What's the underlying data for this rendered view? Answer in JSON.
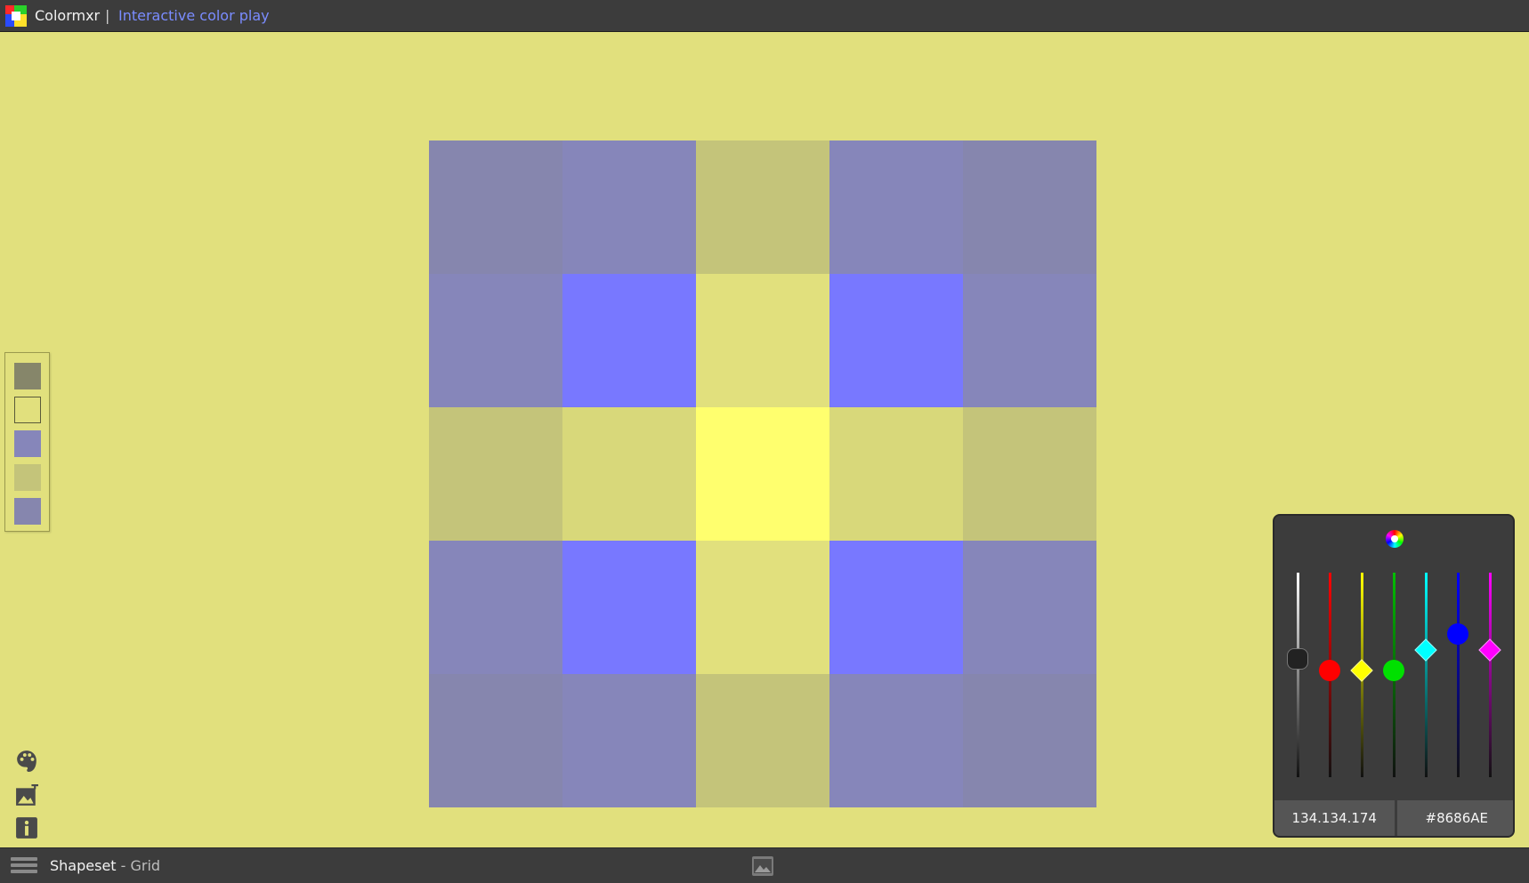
{
  "header": {
    "app_name": "Colormxr",
    "separator": "|",
    "subtitle": "Interactive color play"
  },
  "colors": {
    "background": "#e1e07d",
    "chrome": "#3c3c3c",
    "accent_link": "#7a8cff"
  },
  "grid": {
    "rows": [
      [
        "#8686AE",
        "#8686BA",
        "#C4C47A",
        "#8686BA",
        "#8686AE"
      ],
      [
        "#8686BA",
        "#7878FF",
        "#E1E07D",
        "#7878FF",
        "#8686BA"
      ],
      [
        "#C4C47A",
        "#D8D87A",
        "#FFFF6E",
        "#D8D87A",
        "#C4C47A"
      ],
      [
        "#8686BA",
        "#7878FF",
        "#E1E07D",
        "#7878FF",
        "#8686BA"
      ],
      [
        "#8686AE",
        "#8686BA",
        "#C4C47A",
        "#8686BA",
        "#8686AE"
      ]
    ]
  },
  "swatches": [
    {
      "color": "#86866A",
      "selected": false
    },
    {
      "color": "#E1E07D",
      "selected": true
    },
    {
      "color": "#8686BA",
      "selected": false
    },
    {
      "color": "#C4C47A",
      "selected": false
    },
    {
      "color": "#8686AE",
      "selected": false
    }
  ],
  "tools": [
    {
      "icon": "palette-icon"
    },
    {
      "icon": "add-image-icon"
    },
    {
      "icon": "info-icon"
    }
  ],
  "picker": {
    "icon": "color-wheel-icon",
    "sliders": [
      {
        "name": "black",
        "track": "#ffffff",
        "knob": "#222222",
        "shape": "rounded",
        "level": 0.58
      },
      {
        "name": "red",
        "track": "#ff0000",
        "knob": "#ff0000",
        "shape": "circle",
        "level": 0.52
      },
      {
        "name": "yellow",
        "track": "#ffff00",
        "knob": "#ffff00",
        "shape": "diamond",
        "level": 0.52
      },
      {
        "name": "green",
        "track": "#00c000",
        "knob": "#00e000",
        "shape": "circle",
        "level": 0.52
      },
      {
        "name": "cyan",
        "track": "#00ffff",
        "knob": "#00ffff",
        "shape": "diamond",
        "level": 0.62
      },
      {
        "name": "blue",
        "track": "#0000ff",
        "knob": "#0000ff",
        "shape": "circle",
        "level": 0.7
      },
      {
        "name": "magenta",
        "track": "#ff00ff",
        "knob": "#ff00ff",
        "shape": "diamond",
        "level": 0.62
      }
    ],
    "rgb_value": "134.134.174",
    "hex_value": "#8686AE"
  },
  "footer": {
    "shapeset_label": "Shapeset",
    "shapeset_value": " - Grid",
    "menu_icon": "hamburger-menu-icon",
    "image_icon": "image-icon"
  }
}
